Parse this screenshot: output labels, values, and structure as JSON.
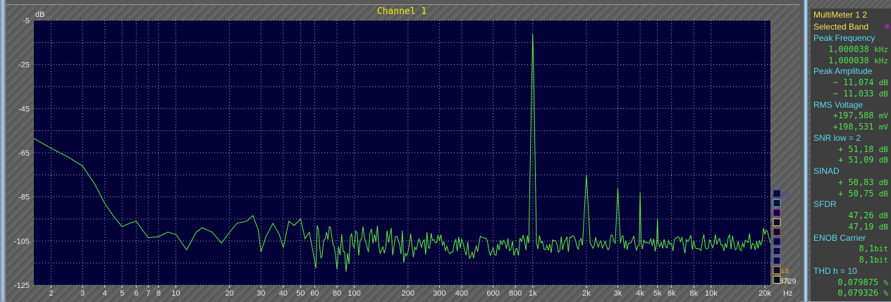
{
  "window": {
    "title": "Channel 1"
  },
  "chart_data": {
    "type": "line",
    "title": "Channel 1",
    "ylabel": "dB",
    "xlabel": "Hz",
    "xscale": "log",
    "xlim": [
      1.6,
      21500
    ],
    "ylim": [
      -125,
      -5
    ],
    "grid": true,
    "y_ticks": [
      -5,
      -25,
      -45,
      -65,
      -85,
      -105,
      -125
    ],
    "x_ticks": [
      {
        "v": 2,
        "l": "2"
      },
      {
        "v": 3,
        "l": "3"
      },
      {
        "v": 4,
        "l": "4"
      },
      {
        "v": 5,
        "l": "5"
      },
      {
        "v": 6,
        "l": "6"
      },
      {
        "v": 7,
        "l": "7"
      },
      {
        "v": 8,
        "l": "8"
      },
      {
        "v": 10,
        "l": "10"
      },
      {
        "v": 20,
        "l": "20"
      },
      {
        "v": 30,
        "l": "30"
      },
      {
        "v": 40,
        "l": "40"
      },
      {
        "v": 50,
        "l": "50"
      },
      {
        "v": 60,
        "l": "60"
      },
      {
        "v": 80,
        "l": "80"
      },
      {
        "v": 100,
        "l": "100"
      },
      {
        "v": 200,
        "l": "200"
      },
      {
        "v": 300,
        "l": "300"
      },
      {
        "v": 400,
        "l": "400"
      },
      {
        "v": 600,
        "l": "600"
      },
      {
        "v": 800,
        "l": "800"
      },
      {
        "v": 1000,
        "l": "1k"
      },
      {
        "v": 2000,
        "l": "2k"
      },
      {
        "v": 3000,
        "l": "3k"
      },
      {
        "v": 4000,
        "l": "4k"
      },
      {
        "v": 5000,
        "l": "5k"
      },
      {
        "v": 6000,
        "l": "6k"
      },
      {
        "v": 8000,
        "l": "8k"
      },
      {
        "v": 10000,
        "l": "10k"
      },
      {
        "v": 20000,
        "l": "20k"
      }
    ],
    "series": [
      {
        "name": "Channel 1",
        "color": "#5cf03c",
        "points": [
          [
            1.6,
            -58.5
          ],
          [
            2,
            -63
          ],
          [
            2.5,
            -67
          ],
          [
            3,
            -71
          ],
          [
            3.5,
            -79
          ],
          [
            4,
            -88
          ],
          [
            4.5,
            -94
          ],
          [
            5,
            -98.5
          ],
          [
            5.5,
            -97
          ],
          [
            6,
            -96
          ],
          [
            6.5,
            -100
          ],
          [
            7,
            -103.5
          ],
          [
            8,
            -103
          ],
          [
            9,
            -101
          ],
          [
            10,
            -102
          ],
          [
            11.5,
            -109
          ],
          [
            13,
            -101
          ],
          [
            14,
            -99
          ],
          [
            16,
            -101
          ],
          [
            18,
            -106
          ],
          [
            20,
            -101
          ],
          [
            22,
            -97
          ],
          [
            25,
            -96
          ],
          [
            27,
            -93.5
          ],
          [
            29,
            -100
          ],
          [
            30,
            -110
          ],
          [
            32,
            -103
          ],
          [
            35,
            -97
          ],
          [
            38,
            -102
          ],
          [
            40,
            -108
          ],
          [
            43,
            -96
          ],
          [
            46,
            -98
          ],
          [
            50,
            -95
          ],
          [
            53,
            -104
          ],
          [
            56,
            -101
          ],
          [
            60,
            -114
          ],
          [
            63,
            -100
          ],
          [
            66,
            -112
          ],
          [
            70,
            -101
          ],
          [
            75,
            -104
          ],
          [
            80,
            -118
          ],
          [
            85,
            -102
          ],
          [
            90,
            -119
          ],
          [
            95,
            -103
          ],
          [
            100,
            -108
          ],
          [
            110,
            -104
          ],
          [
            120,
            -110
          ],
          [
            130,
            -102
          ],
          [
            150,
            -108
          ],
          [
            170,
            -103
          ],
          [
            200,
            -110
          ],
          [
            230,
            -104
          ],
          [
            260,
            -108
          ],
          [
            300,
            -105
          ],
          [
            350,
            -110
          ],
          [
            400,
            -104
          ],
          [
            450,
            -112
          ],
          [
            500,
            -106
          ],
          [
            600,
            -108
          ],
          [
            700,
            -106
          ],
          [
            800,
            -109
          ],
          [
            900,
            -105
          ],
          [
            950,
            -106
          ],
          [
            1000,
            -11
          ],
          [
            1010,
            -24
          ],
          [
            1050,
            -106
          ],
          [
            1200,
            -107
          ],
          [
            1500,
            -106
          ],
          [
            1900,
            -107
          ],
          [
            2000,
            -75
          ],
          [
            2100,
            -106
          ],
          [
            2500,
            -107
          ],
          [
            2900,
            -106
          ],
          [
            3000,
            -81
          ],
          [
            3100,
            -106
          ],
          [
            3500,
            -106
          ],
          [
            3950,
            -107
          ],
          [
            4000,
            -83
          ],
          [
            4050,
            -106
          ],
          [
            4500,
            -106
          ],
          [
            4950,
            -106
          ],
          [
            5000,
            -95
          ],
          [
            5050,
            -106
          ],
          [
            6000,
            -106
          ],
          [
            7000,
            -107
          ],
          [
            8000,
            -105
          ],
          [
            10000,
            -106
          ],
          [
            12000,
            -106
          ],
          [
            15000,
            -106
          ],
          [
            18000,
            -105
          ],
          [
            20000,
            -102
          ],
          [
            21000,
            -103
          ],
          [
            21500,
            -106
          ]
        ]
      }
    ],
    "noise_jitter_db": 4,
    "legend": {
      "items": [
        "L0",
        "",
        "",
        "",
        "",
        "",
        "",
        "",
        "L8",
        "L9"
      ],
      "colors": [
        "#3b3bd0",
        "#4ab0ff",
        "#c040c0",
        "#f0e070",
        "#b06060",
        "#5050d0",
        "#7070e0",
        "#7070e0",
        "#f0a030",
        "#e0e060"
      ],
      "placement": "right"
    },
    "corner_value": "0,6729"
  },
  "meter": {
    "title": "MultiMeter  1 2",
    "selected_band": "Selected Band",
    "rows": [
      {
        "t": "lab",
        "text": "Peak Frequency"
      },
      {
        "t": "val",
        "text": "1,000038 ",
        "unit": "kHz"
      },
      {
        "t": "val",
        "text": "1,000038 ",
        "unit": "kHz"
      },
      {
        "t": "lab",
        "text": "Peak Amplitude"
      },
      {
        "t": "val",
        "text": "− 11,074 ",
        "unit": "dB"
      },
      {
        "t": "val",
        "text": "− 11,033 ",
        "unit": "dB"
      },
      {
        "t": "lab",
        "text": "RMS Voltage"
      },
      {
        "t": "val",
        "text": "+197,588 ",
        "unit": "mV"
      },
      {
        "t": "val",
        "text": "+198,531 ",
        "unit": "mV"
      },
      {
        "t": "lab",
        "text": "SNR    low = 2"
      },
      {
        "t": "val",
        "text": "+ 51,18 ",
        "unit": "dB"
      },
      {
        "t": "val",
        "text": "+ 51,09 ",
        "unit": "dB"
      },
      {
        "t": "lab",
        "text": "SINAD"
      },
      {
        "t": "val",
        "text": "+ 50,83 ",
        "unit": "dB"
      },
      {
        "t": "val",
        "text": "+ 50,75 ",
        "unit": "dB"
      },
      {
        "t": "lab",
        "text": "SFDR"
      },
      {
        "t": "val",
        "text": "47,26 ",
        "unit": "dB"
      },
      {
        "t": "val",
        "text": "47,19 ",
        "unit": "dB"
      },
      {
        "t": "lab",
        "text": "ENOB     Carrier"
      },
      {
        "t": "val",
        "text": "8,1",
        "unit": "bit"
      },
      {
        "t": "val",
        "text": "8,1",
        "unit": "bit"
      },
      {
        "t": "lab",
        "text": "THD      h = 10"
      },
      {
        "t": "val",
        "text": "0,079875 ",
        "unit": "%"
      },
      {
        "t": "val",
        "text": "0,079326 ",
        "unit": "%"
      }
    ]
  }
}
